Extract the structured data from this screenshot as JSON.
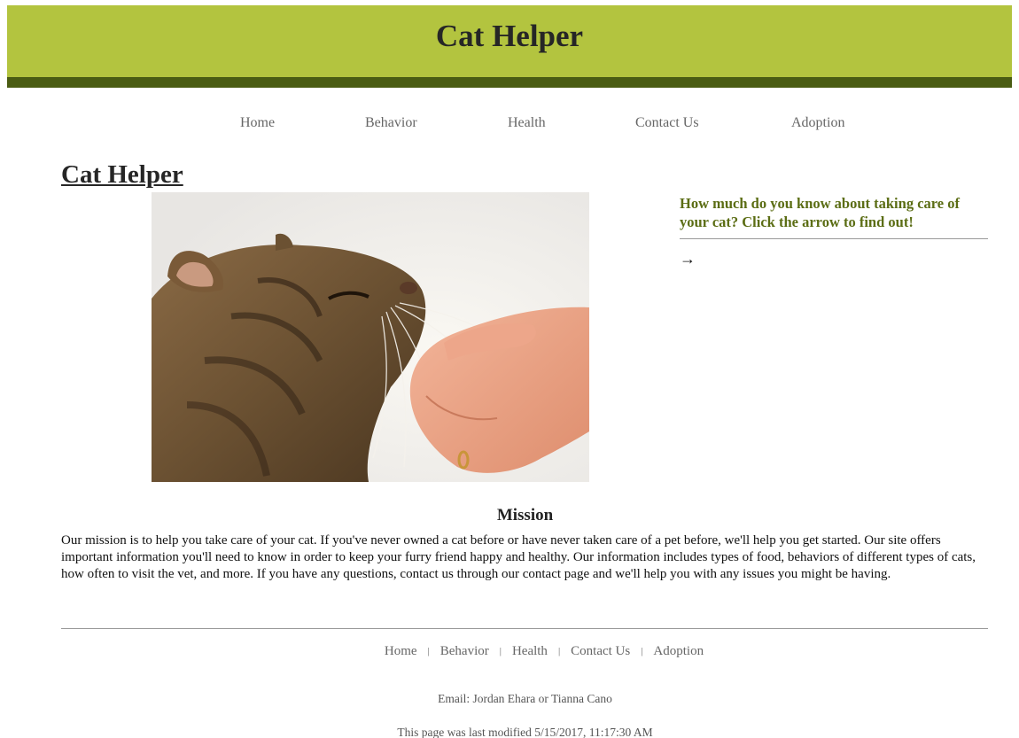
{
  "site_title": "Cat Helper",
  "nav": {
    "items": [
      {
        "label": "Home"
      },
      {
        "label": "Behavior"
      },
      {
        "label": "Health"
      },
      {
        "label": "Contact Us"
      },
      {
        "label": "Adoption"
      }
    ]
  },
  "main": {
    "heading": "Cat Helper",
    "image": {
      "icon": "cat-photo"
    }
  },
  "aside": {
    "question": "How much do you know about taking care of your cat? Click the arrow to find out!",
    "arrow": "→"
  },
  "mission": {
    "title": "Mission",
    "text": "Our mission is to help you take care of your cat. If you've never owned a cat before or have never taken care of a pet before, we'll help you get started. Our site offers important information you'll need to know in order to keep your furry friend happy and healthy. Our information includes types of food, behaviors of different types of cats, how often to visit the vet, and more. If you have any questions, contact us through our contact page and we'll help you with any issues you might be having."
  },
  "footer": {
    "nav": [
      {
        "label": "Home"
      },
      {
        "label": "Behavior"
      },
      {
        "label": "Health"
      },
      {
        "label": "Contact Us"
      },
      {
        "label": "Adoption"
      }
    ],
    "separator": "|",
    "email": "Email: Jordan Ehara or Tianna Cano",
    "last_modified": "This page was last modified 5/15/2017, 11:17:30 AM"
  },
  "colors": {
    "header_bg": "#b3c43f",
    "header_bar": "#4a5c13",
    "accent_text": "#5b6d14"
  }
}
